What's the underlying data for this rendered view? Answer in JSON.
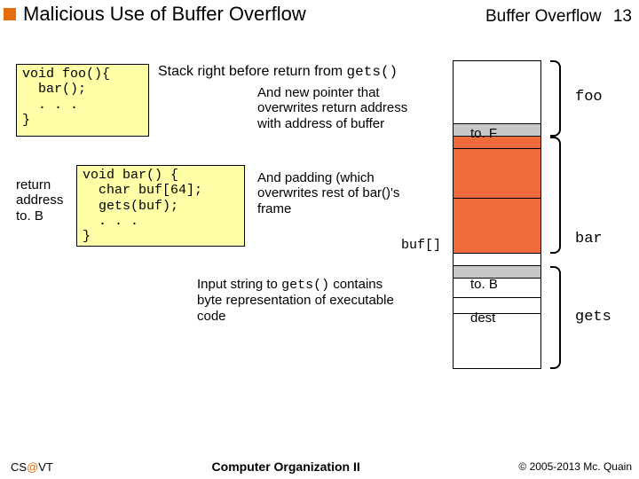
{
  "header": {
    "title": "Malicious Use of Buffer Overflow",
    "right_text": "Buffer Overflow",
    "page_num": "13"
  },
  "code_foo": "void foo(){\n  bar();\n  . . .\n}",
  "code_bar": "void bar() {\n  char buf[64];\n  gets(buf);\n  . . .\n}",
  "ra_label": "return\naddress\nto. B",
  "stack_title_a": "Stack right before return from ",
  "stack_title_b": "gets()",
  "ann1": "And new pointer that overwrites return address with address of buffer",
  "ann2": "And padding (which overwrites rest of bar()'s frame",
  "ann3_a": "Input string to ",
  "ann3_b": "gets()",
  "ann3_c": " contains byte representation of executable code",
  "stack_labels": {
    "toF": "to. F",
    "buf": "buf[]",
    "toB": "to. B",
    "dest": "dest"
  },
  "brace_labels": {
    "foo": "foo",
    "bar": "bar",
    "gets": "gets"
  },
  "footer": {
    "left_a": "CS",
    "left_b": "@",
    "left_c": "VT",
    "center": "Computer Organization II",
    "right": "© 2005-2013 Mc. Quain"
  }
}
